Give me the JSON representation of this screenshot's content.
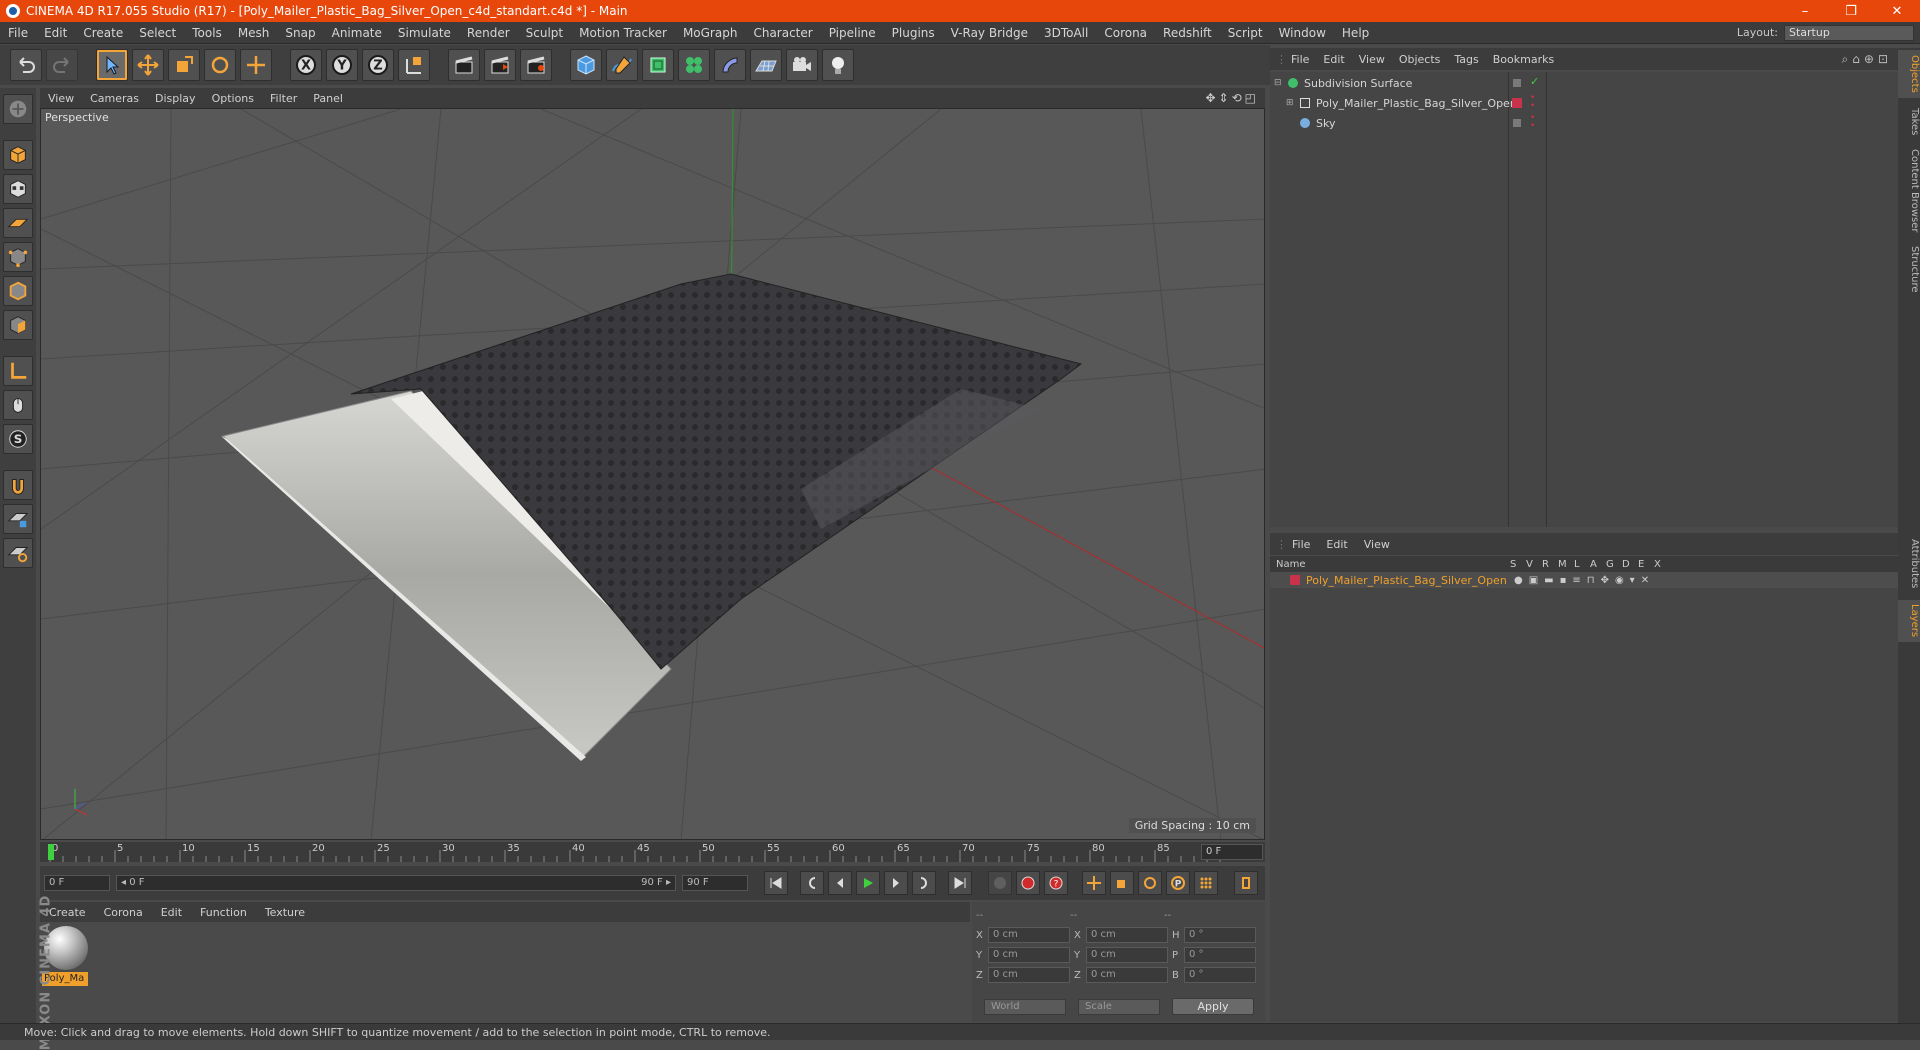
{
  "window": {
    "title": "CINEMA 4D R17.055 Studio (R17) - [Poly_Mailer_Plastic_Bag_Silver_Open_c4d_standart.c4d *] - Main",
    "controls": [
      "–",
      "❐",
      "✕"
    ]
  },
  "menubar": {
    "items": [
      "File",
      "Edit",
      "Create",
      "Select",
      "Tools",
      "Mesh",
      "Snap",
      "Animate",
      "Simulate",
      "Render",
      "Sculpt",
      "Motion Tracker",
      "MoGraph",
      "Character",
      "Pipeline",
      "Plugins",
      "V-Ray Bridge",
      "3DToAll",
      "Corona",
      "Redshift",
      "Script",
      "Window",
      "Help"
    ],
    "layout_label": "Layout:",
    "layout_value": "Startup"
  },
  "viewport": {
    "menu": [
      "View",
      "Cameras",
      "Display",
      "Options",
      "Filter",
      "Panel"
    ],
    "label": "Perspective",
    "grid_spacing": "Grid Spacing : 10 cm"
  },
  "timeline": {
    "ticks": [
      "0",
      "5",
      "10",
      "15",
      "20",
      "25",
      "30",
      "35",
      "40",
      "45",
      "50",
      "55",
      "60",
      "65",
      "70",
      "75",
      "80",
      "85",
      "90"
    ],
    "current_frame": "0 F",
    "start_field": "0 F",
    "range_start": "◂ 0 F",
    "range_end": "90 F ▸",
    "end_field": "90 F"
  },
  "material_manager": {
    "menu": [
      "Create",
      "Corona",
      "Edit",
      "Function",
      "Texture"
    ],
    "material_name": "Poly_Ma"
  },
  "coordinates": {
    "headers": [
      "--",
      "--",
      "--"
    ],
    "rows": [
      {
        "a": "X",
        "av": "0 cm",
        "b": "X",
        "bv": "0 cm",
        "c": "H",
        "cv": "0 °"
      },
      {
        "a": "Y",
        "av": "0 cm",
        "b": "Y",
        "bv": "0 cm",
        "c": "P",
        "cv": "0 °"
      },
      {
        "a": "Z",
        "av": "0 cm",
        "b": "Z",
        "bv": "0 cm",
        "c": "B",
        "cv": "0 °"
      }
    ],
    "mode1": "World",
    "mode2": "Scale",
    "apply": "Apply"
  },
  "object_manager": {
    "menu": [
      "File",
      "Edit",
      "View",
      "Objects",
      "Tags",
      "Bookmarks"
    ],
    "objects": [
      "Subdivision Surface",
      "Poly_Mailer_Plastic_Bag_Silver_Open",
      "Sky"
    ]
  },
  "layer_manager": {
    "menu": [
      "File",
      "Edit",
      "View"
    ],
    "columns": [
      "Name",
      "S",
      "V",
      "R",
      "M",
      "L",
      "A",
      "G",
      "D",
      "E",
      "X"
    ],
    "layer_name": "Poly_Mailer_Plastic_Bag_Silver_Open",
    "layer_color": "#c8324a"
  },
  "right_tabs": [
    "Objects",
    "Takes",
    "Content Browser",
    "Structure",
    "Attributes",
    "Layers"
  ],
  "brand": "MAXON CINEMA 4D",
  "status": "Move: Click and drag to move elements. Hold down SHIFT to quantize movement / add to the selection in point mode, CTRL to remove.",
  "colors": {
    "titlebar": "#e8470c",
    "accent": "#f0a02a"
  }
}
